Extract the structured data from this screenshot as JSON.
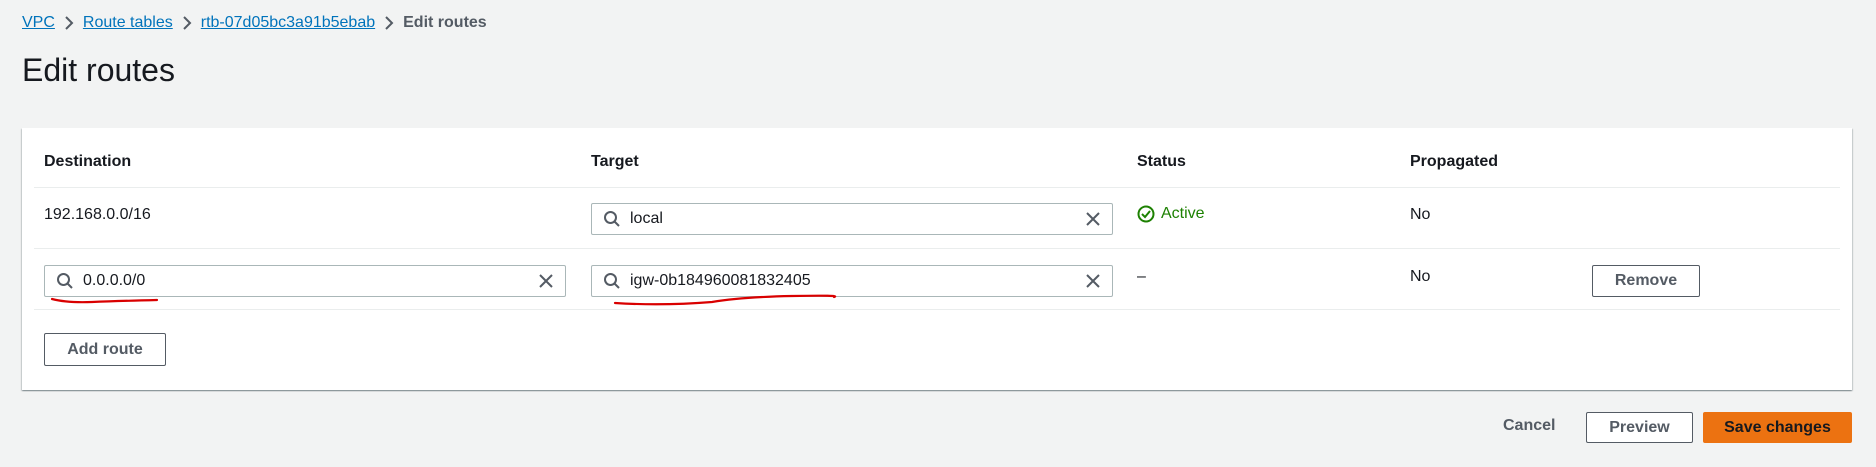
{
  "breadcrumb": {
    "items": [
      "VPC",
      "Route tables",
      "rtb-07d05bc3a91b5ebab"
    ],
    "current": "Edit routes"
  },
  "page": {
    "title": "Edit routes"
  },
  "table": {
    "headers": {
      "destination": "Destination",
      "target": "Target",
      "status": "Status",
      "propagated": "Propagated"
    },
    "rows": [
      {
        "destination": "192.168.0.0/16",
        "target": "local",
        "status": "Active",
        "propagated": "No"
      },
      {
        "destination": "0.0.0.0/0",
        "target": "igw-0b184960081832405",
        "status": "–",
        "propagated": "No",
        "remove_label": "Remove"
      }
    ],
    "add_route_label": "Add route"
  },
  "footer": {
    "cancel_label": "Cancel",
    "preview_label": "Preview",
    "save_label": "Save changes"
  },
  "colors": {
    "link": "#0073bb",
    "primary": "#ec7211",
    "success": "#1d8102",
    "annotation": "#d90000"
  },
  "icons": {
    "breadcrumb_separator": "chevron-right-icon",
    "search": "search-icon",
    "clear": "close-icon",
    "status": "check-circle-icon"
  }
}
